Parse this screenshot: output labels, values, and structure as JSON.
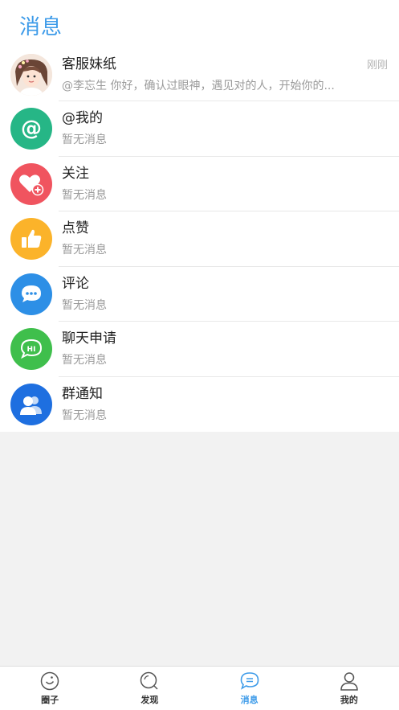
{
  "header": {
    "title": "消息"
  },
  "messages": [
    {
      "title": "客服妹纸",
      "subtitle": "@李忘生 你好，确认过眼神，遇见对的人，开始你的...",
      "time": "刚刚",
      "icon": "avatar-photo",
      "color": "#f3e3d8"
    },
    {
      "title": "@我的",
      "subtitle": "暂无消息",
      "icon": "at-icon",
      "color": "#26b686"
    },
    {
      "title": "关注",
      "subtitle": "暂无消息",
      "icon": "heart-plus-icon",
      "color": "#f0545f"
    },
    {
      "title": "点赞",
      "subtitle": "暂无消息",
      "icon": "thumbs-up-icon",
      "color": "#fbb32a"
    },
    {
      "title": "评论",
      "subtitle": "暂无消息",
      "icon": "comment-icon",
      "color": "#2d8fe6"
    },
    {
      "title": "聊天申请",
      "subtitle": "暂无消息",
      "icon": "chat-hi-icon",
      "color": "#3fbf4c"
    },
    {
      "title": "群通知",
      "subtitle": "暂无消息",
      "icon": "group-icon",
      "color": "#1e6fe0"
    }
  ],
  "tabbar": {
    "active_color": "#3d9be9",
    "tabs": [
      {
        "label": "圈子",
        "icon": "circle-icon"
      },
      {
        "label": "发现",
        "icon": "discover-icon"
      },
      {
        "label": "消息",
        "icon": "message-icon",
        "active": true
      },
      {
        "label": "我的",
        "icon": "profile-icon"
      }
    ]
  }
}
